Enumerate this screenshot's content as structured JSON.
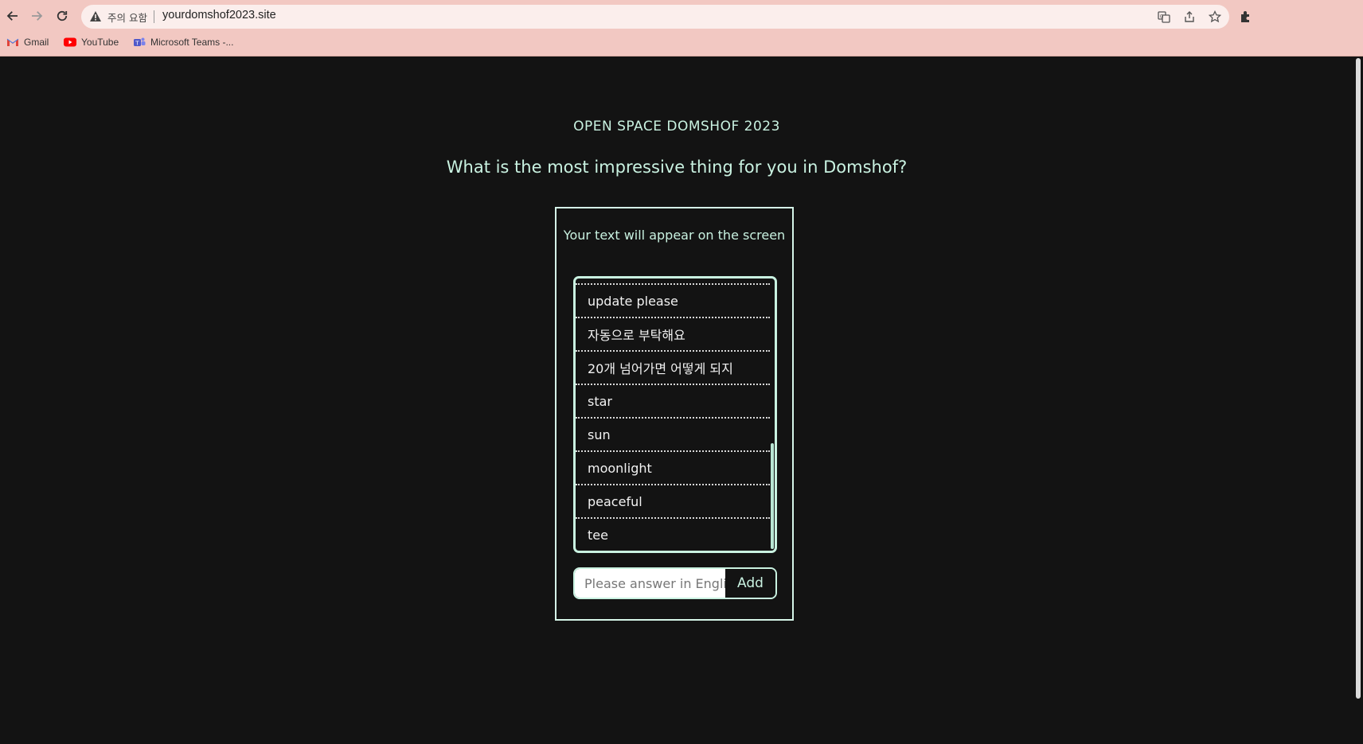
{
  "browser": {
    "security_warning": "주의 요함",
    "url": "yourdomshof2023.site",
    "bookmarks": [
      {
        "label": "Gmail",
        "icon": "gmail-icon"
      },
      {
        "label": "YouTube",
        "icon": "youtube-icon"
      },
      {
        "label": "Microsoft Teams -...",
        "icon": "teams-icon"
      }
    ]
  },
  "page": {
    "site_title": "OPEN SPACE DOMSHOF 2023",
    "question": "What is the most impressive thing for you in Domshof?",
    "card_title": "Your text will appear on the screen",
    "answers": [
      "update please",
      "자동으로 부탁해요",
      "20개 넘어가면 어떻게 되지",
      "star",
      "sun",
      "moonlight",
      "peaceful",
      "tee"
    ],
    "input": {
      "placeholder": "Please answer in English",
      "value": ""
    },
    "add_label": "Add"
  },
  "colors": {
    "background": "#131313",
    "accent": "#c9f2e1",
    "chrome": "#f2c8c2"
  }
}
